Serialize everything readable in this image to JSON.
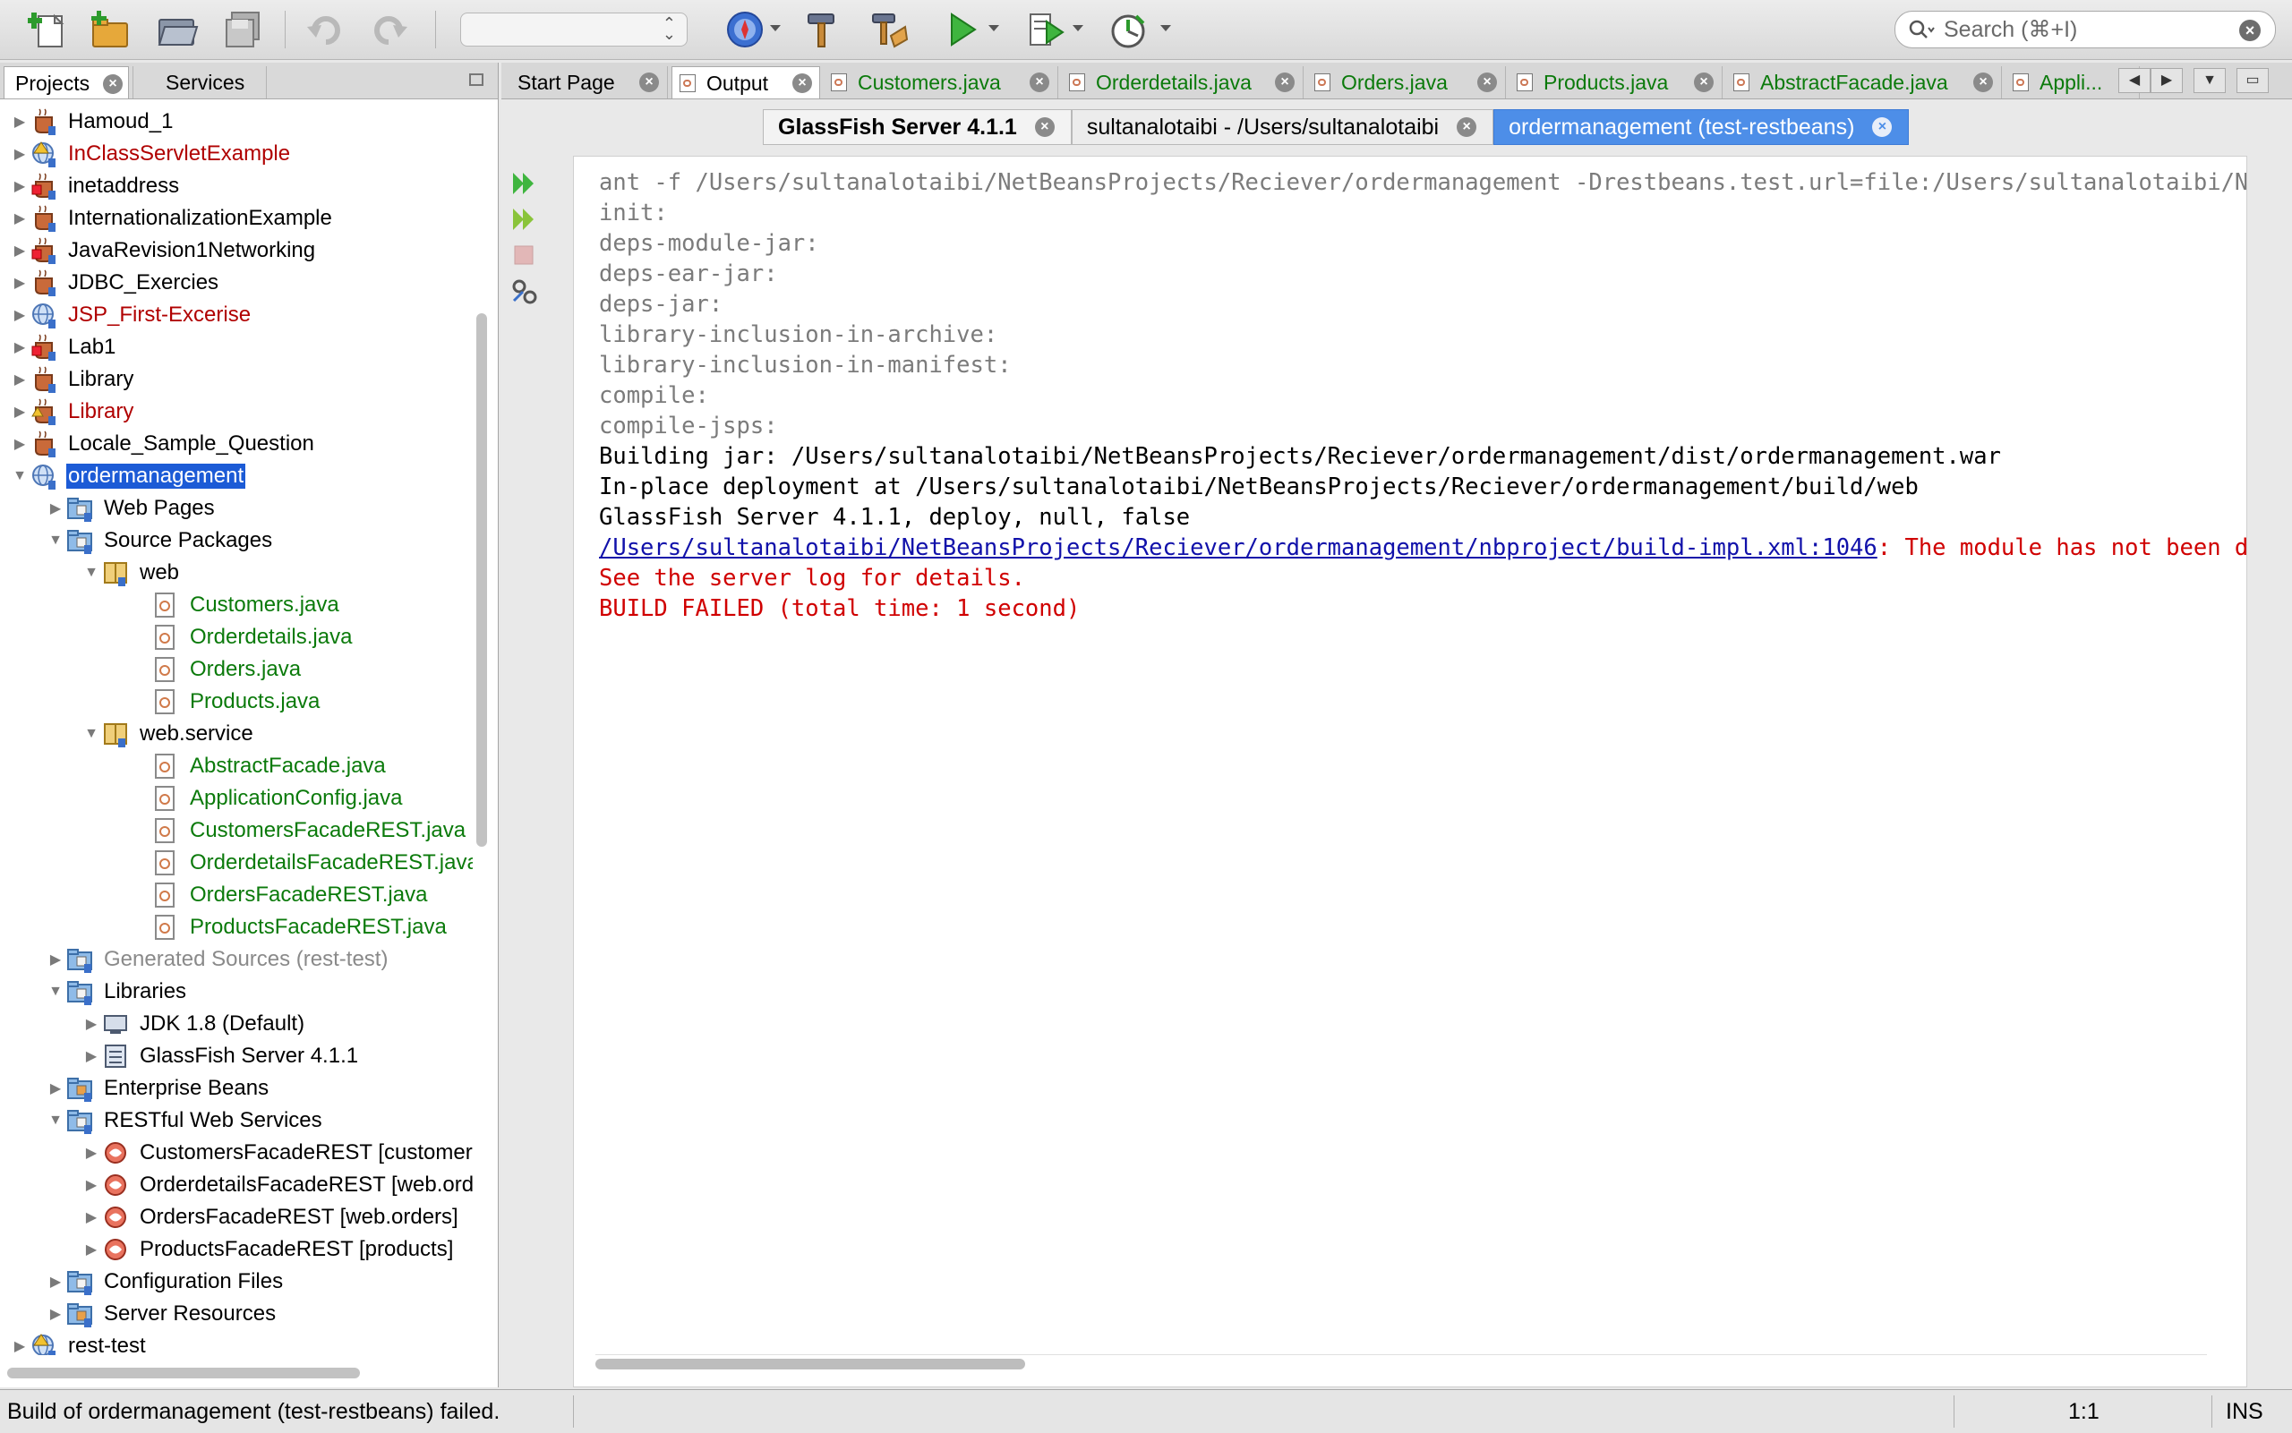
{
  "toolbar": {
    "config_value": "",
    "search": {
      "placeholder": "Search (⌘+I)"
    },
    "icons": [
      "new-file-icon",
      "new-project-icon",
      "open-project-icon",
      "save-all-icon",
      "undo-icon",
      "redo-icon",
      "browser-icon",
      "build-hammer-icon",
      "clean-build-icon",
      "run-icon",
      "debug-icon",
      "profile-icon"
    ]
  },
  "left_panel": {
    "tabs": [
      {
        "label": "Projects"
      },
      {
        "label": "Services"
      }
    ],
    "tree": [
      {
        "label": "Hamoud_1",
        "level": 0,
        "expanded": false,
        "icon": "java-project-icon",
        "color": "normal"
      },
      {
        "label": "InClassServletExample",
        "level": 0,
        "expanded": false,
        "icon": "web-project-warning-icon",
        "color": "red"
      },
      {
        "label": "inetaddress",
        "level": 0,
        "expanded": false,
        "icon": "java-project-error-icon",
        "color": "normal"
      },
      {
        "label": "InternationalizationExample",
        "level": 0,
        "expanded": false,
        "icon": "java-project-icon",
        "color": "normal"
      },
      {
        "label": "JavaRevision1Networking",
        "level": 0,
        "expanded": false,
        "icon": "java-project-error-icon",
        "color": "normal"
      },
      {
        "label": "JDBC_Exercies",
        "level": 0,
        "expanded": false,
        "icon": "java-project-icon",
        "color": "normal"
      },
      {
        "label": "JSP_First-Excerise",
        "level": 0,
        "expanded": false,
        "icon": "web-project-icon",
        "color": "red"
      },
      {
        "label": "Lab1",
        "level": 0,
        "expanded": false,
        "icon": "java-project-error-icon",
        "color": "normal"
      },
      {
        "label": "Library",
        "level": 0,
        "expanded": false,
        "icon": "java-project-icon",
        "color": "normal"
      },
      {
        "label": "Library",
        "level": 0,
        "expanded": false,
        "icon": "java-project-warning-icon",
        "color": "red"
      },
      {
        "label": "Locale_Sample_Question",
        "level": 0,
        "expanded": false,
        "icon": "java-project-icon",
        "color": "normal"
      },
      {
        "label": "ordermanagement",
        "level": 0,
        "expanded": true,
        "icon": "web-project-icon",
        "color": "selected"
      },
      {
        "label": "Web Pages",
        "level": 1,
        "expanded": false,
        "icon": "folder-web-icon",
        "color": "normal"
      },
      {
        "label": "Source Packages",
        "level": 1,
        "expanded": true,
        "icon": "folder-source-icon",
        "color": "normal"
      },
      {
        "label": "web",
        "level": 2,
        "expanded": true,
        "icon": "package-icon",
        "color": "normal"
      },
      {
        "label": "Customers.java",
        "level": 3,
        "icon": "java-file-icon",
        "color": "green"
      },
      {
        "label": "Orderdetails.java",
        "level": 3,
        "icon": "java-file-icon",
        "color": "green"
      },
      {
        "label": "Orders.java",
        "level": 3,
        "icon": "java-file-icon",
        "color": "green"
      },
      {
        "label": "Products.java",
        "level": 3,
        "icon": "java-file-icon",
        "color": "green"
      },
      {
        "label": "web.service",
        "level": 2,
        "expanded": true,
        "icon": "package-icon",
        "color": "normal"
      },
      {
        "label": "AbstractFacade.java",
        "level": 3,
        "icon": "java-file-icon",
        "color": "green"
      },
      {
        "label": "ApplicationConfig.java",
        "level": 3,
        "icon": "java-file-icon",
        "color": "green"
      },
      {
        "label": "CustomersFacadeREST.java",
        "level": 3,
        "icon": "java-file-icon",
        "color": "green"
      },
      {
        "label": "OrderdetailsFacadeREST.java",
        "level": 3,
        "icon": "java-file-icon",
        "color": "green"
      },
      {
        "label": "OrdersFacadeREST.java",
        "level": 3,
        "icon": "java-file-icon",
        "color": "green"
      },
      {
        "label": "ProductsFacadeREST.java",
        "level": 3,
        "icon": "java-file-icon",
        "color": "green"
      },
      {
        "label": "Generated Sources (rest-test)",
        "level": 1,
        "expanded": false,
        "icon": "folder-generated-icon",
        "color": "gray"
      },
      {
        "label": "Libraries",
        "level": 1,
        "expanded": true,
        "icon": "folder-library-icon",
        "color": "normal"
      },
      {
        "label": "JDK 1.8 (Default)",
        "level": 2,
        "expanded": false,
        "icon": "jdk-icon",
        "color": "normal"
      },
      {
        "label": "GlassFish Server 4.1.1",
        "level": 2,
        "expanded": false,
        "icon": "server-library-icon",
        "color": "normal"
      },
      {
        "label": "Enterprise Beans",
        "level": 1,
        "expanded": false,
        "icon": "folder-beans-icon",
        "color": "normal"
      },
      {
        "label": "RESTful Web Services",
        "level": 1,
        "expanded": true,
        "icon": "folder-rest-icon",
        "color": "normal"
      },
      {
        "label": "CustomersFacadeREST [customers]",
        "level": 2,
        "expanded": false,
        "icon": "rest-service-icon",
        "color": "normal"
      },
      {
        "label": "OrderdetailsFacadeREST [web.orderdetails]",
        "level": 2,
        "expanded": false,
        "icon": "rest-service-icon",
        "color": "normal"
      },
      {
        "label": "OrdersFacadeREST [web.orders]",
        "level": 2,
        "expanded": false,
        "icon": "rest-service-icon",
        "color": "normal"
      },
      {
        "label": "ProductsFacadeREST [products]",
        "level": 2,
        "expanded": false,
        "icon": "rest-service-icon",
        "color": "normal"
      },
      {
        "label": "Configuration Files",
        "level": 1,
        "expanded": false,
        "icon": "folder-config-icon",
        "color": "normal"
      },
      {
        "label": "Server Resources",
        "level": 1,
        "expanded": false,
        "icon": "folder-resources-icon",
        "color": "normal"
      },
      {
        "label": "rest-test",
        "level": 0,
        "expanded": false,
        "icon": "web-project-error-icon",
        "color": "normal"
      }
    ]
  },
  "editor": {
    "tabs": [
      {
        "label": "Start Page",
        "icon": "none",
        "color": "normal"
      },
      {
        "label": "Output",
        "icon": "output-icon",
        "color": "normal",
        "active": true
      },
      {
        "label": "Customers.java",
        "icon": "java-file-icon",
        "color": "green"
      },
      {
        "label": "Orderdetails.java",
        "icon": "java-file-icon",
        "color": "green"
      },
      {
        "label": "Orders.java",
        "icon": "java-file-icon",
        "color": "green"
      },
      {
        "label": "Products.java",
        "icon": "java-file-icon",
        "color": "green"
      },
      {
        "label": "AbstractFacade.java",
        "icon": "java-file-icon",
        "color": "green"
      },
      {
        "label": "Appli...",
        "icon": "java-file-icon",
        "color": "green"
      }
    ],
    "output_subtabs": [
      {
        "label": "GlassFish Server 4.1.1",
        "style": "bold"
      },
      {
        "label": "sultanalotaibi - /Users/sultanalotaibi",
        "style": "normal"
      },
      {
        "label": "ordermanagement (test-restbeans)",
        "style": "active"
      }
    ],
    "output_lines": [
      {
        "text": "ant -f /Users/sultanalotaibi/NetBeansProjects/Reciever/ordermanagement -Drestbeans.test.url=file:/Users/sultanalotaibi/NetBeansProjects/Reciever/ordermanagement/build/generated-sources/rest-test/test-resbeans.html",
        "style": "gray"
      },
      {
        "text": "init:",
        "style": "gray"
      },
      {
        "text": "deps-module-jar:",
        "style": "gray"
      },
      {
        "text": "deps-ear-jar:",
        "style": "gray"
      },
      {
        "text": "deps-jar:",
        "style": "gray"
      },
      {
        "text": "library-inclusion-in-archive:",
        "style": "gray"
      },
      {
        "text": "library-inclusion-in-manifest:",
        "style": "gray"
      },
      {
        "text": "compile:",
        "style": "gray"
      },
      {
        "text": "compile-jsps:",
        "style": "gray"
      },
      {
        "text": "Building jar: /Users/sultanalotaibi/NetBeansProjects/Reciever/ordermanagement/dist/ordermanagement.war",
        "style": "black"
      },
      {
        "text": "In-place deployment at /Users/sultanalotaibi/NetBeansProjects/Reciever/ordermanagement/build/web",
        "style": "black"
      },
      {
        "text": "GlassFish Server 4.1.1, deploy, null, false",
        "style": "black"
      },
      {
        "link": "/Users/sultanalotaibi/NetBeansProjects/Reciever/ordermanagement/nbproject/build-impl.xml:1046",
        "text": ": The module has not been deployed.",
        "style": "red"
      },
      {
        "text": "See the server log for details.",
        "style": "red"
      },
      {
        "text": "BUILD FAILED (total time: 1 second)",
        "style": "red"
      }
    ]
  },
  "status_bar": {
    "message": "Build of ordermanagement (test-restbeans) failed.",
    "position": "1:1",
    "mode": "INS"
  },
  "colors": {
    "selection": "#1c5bd6",
    "error_text": "#d00000",
    "modified_file": "#0b7a0b",
    "active_subtab": "#4d8ee8",
    "link": "#1111aa"
  }
}
